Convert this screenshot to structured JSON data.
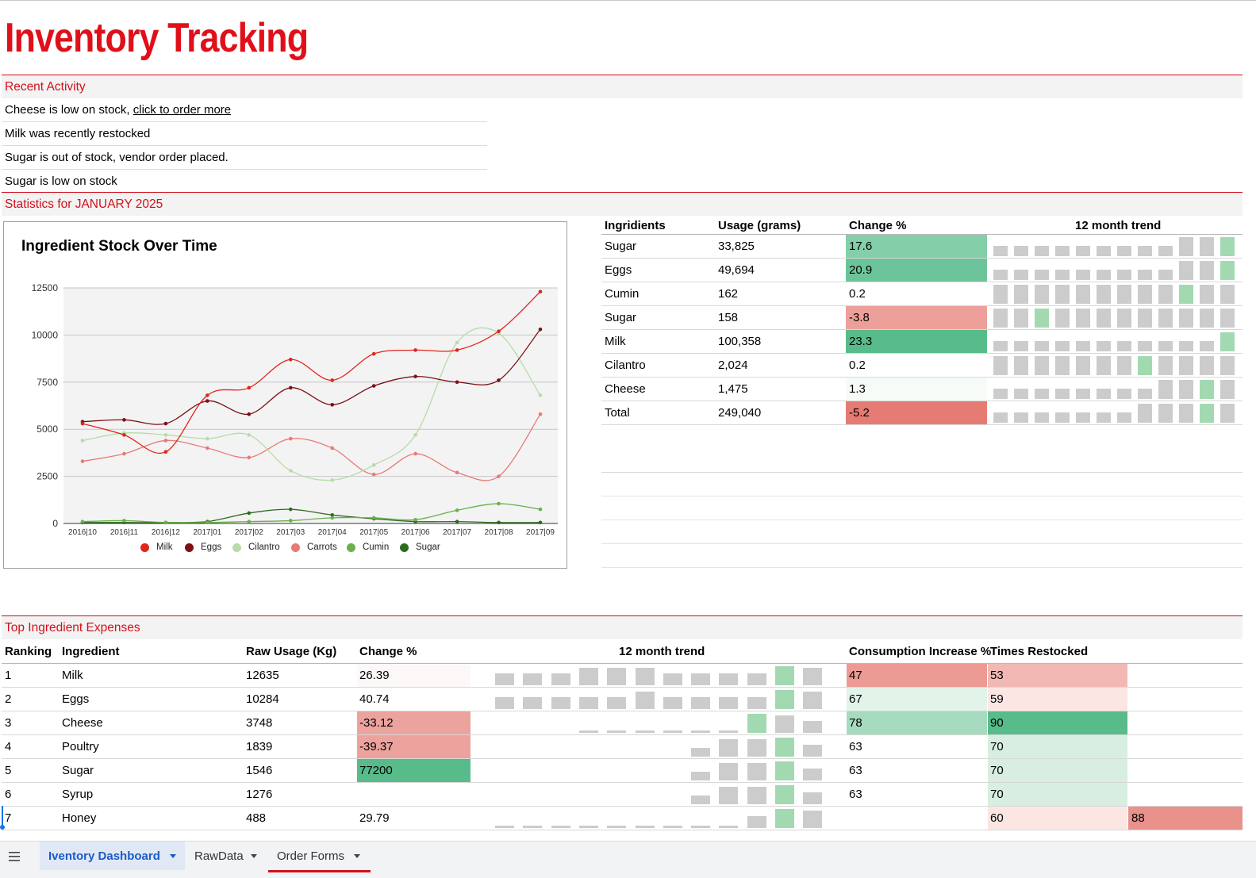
{
  "page_title": "Inventory Tracking",
  "recent_activity": {
    "heading": "Recent Activity",
    "items": [
      {
        "text": "Cheese is low on stock, ",
        "link": "click to order more"
      },
      {
        "text": "Milk was recently restocked"
      },
      {
        "text": "Sugar is out of stock, vendor order placed."
      },
      {
        "text": "Sugar is low on stock"
      }
    ]
  },
  "statistics": {
    "heading": "Statistics for JANUARY 2025",
    "table": {
      "headers": [
        "Ingridients",
        "Usage (grams)",
        "Change %",
        "12 month trend"
      ],
      "rows": [
        {
          "name": "Sugar",
          "usage": "33,825",
          "change": "17.6",
          "color": "#84ceaa",
          "trend": [
            1,
            1,
            1,
            1,
            1,
            1,
            1,
            1,
            1,
            2,
            2,
            2
          ],
          "hi": 11
        },
        {
          "name": "Eggs",
          "usage": "49,694",
          "change": "20.9",
          "color": "#6cc59a",
          "trend": [
            1,
            1,
            1,
            1,
            1,
            1,
            1,
            1,
            1,
            2,
            2,
            2
          ],
          "hi": 11
        },
        {
          "name": "Cumin",
          "usage": "162",
          "change": "0.2",
          "color": "",
          "trend": [
            2,
            2,
            2,
            2,
            2,
            2,
            2,
            2,
            2,
            2,
            2,
            2
          ],
          "hi": 9
        },
        {
          "name": "Sugar",
          "usage": "158",
          "change": "-3.8",
          "color": "#eda09a",
          "trend": [
            2,
            2,
            2,
            2,
            2,
            2,
            2,
            2,
            2,
            2,
            2,
            2
          ],
          "hi": 2
        },
        {
          "name": "Milk",
          "usage": "100,358",
          "change": "23.3",
          "color": "#58bb8a",
          "trend": [
            1,
            1,
            1,
            1,
            1,
            1,
            1,
            1,
            1,
            1,
            1,
            2
          ],
          "hi": 11
        },
        {
          "name": "Cilantro",
          "usage": "2,024",
          "change": "0.2",
          "color": "",
          "trend": [
            2,
            2,
            2,
            2,
            2,
            2,
            2,
            2,
            2,
            2,
            2,
            2
          ],
          "hi": 7
        },
        {
          "name": "Cheese",
          "usage": "1,475",
          "change": "1.3",
          "color": "#f6fbf8",
          "trend": [
            1,
            1,
            1,
            1,
            1,
            1,
            1,
            1,
            2,
            2,
            2,
            2
          ],
          "hi": 10
        },
        {
          "name": "Total",
          "usage": "249,040",
          "change": "-5.2",
          "color": "#e67b73",
          "trend": [
            1,
            1,
            1,
            1,
            1,
            1,
            1,
            2,
            2,
            2,
            2,
            2
          ],
          "hi": 10
        }
      ]
    }
  },
  "chart_data": {
    "type": "line",
    "title": "Ingredient Stock Over Time",
    "categories": [
      "2016|10",
      "2016|11",
      "2016|12",
      "2017|01",
      "2017|02",
      "2017|03",
      "2017|04",
      "2017|05",
      "2017|06",
      "2017|07",
      "2017|08",
      "2017|09"
    ],
    "ylim": [
      0,
      12500
    ],
    "yticks": [
      "12500",
      "10000",
      "7500",
      "5000",
      "2500",
      "0"
    ],
    "grid": true,
    "legend_position": "bottom",
    "series": [
      {
        "name": "Milk",
        "color": "#e1251b",
        "values": [
          5300,
          4700,
          3800,
          6800,
          7200,
          8700,
          7600,
          9000,
          9200,
          9200,
          10200,
          12300
        ]
      },
      {
        "name": "Eggs",
        "color": "#7b1116",
        "values": [
          5400,
          5500,
          5300,
          6500,
          5800,
          7200,
          6300,
          7300,
          7800,
          7500,
          7600,
          10300
        ]
      },
      {
        "name": "Cilantro",
        "color": "#b7dca9",
        "values": [
          4400,
          4800,
          4700,
          4500,
          4700,
          2800,
          2300,
          3100,
          4700,
          9600,
          10100,
          6800
        ]
      },
      {
        "name": "Carrots",
        "color": "#e87a76",
        "values": [
          3300,
          3700,
          4400,
          4000,
          3500,
          4500,
          4000,
          2600,
          3700,
          2700,
          2500,
          5800
        ]
      },
      {
        "name": "Cumin",
        "color": "#6ab04c",
        "values": [
          100,
          150,
          50,
          50,
          100,
          150,
          300,
          300,
          200,
          700,
          1050,
          750
        ]
      },
      {
        "name": "Sugar",
        "color": "#2e6b1f",
        "values": [
          50,
          50,
          50,
          100,
          550,
          750,
          450,
          250,
          100,
          100,
          50,
          50
        ]
      }
    ]
  },
  "expenses": {
    "heading": "Top Ingredient Expenses",
    "headers": [
      "Ranking",
      "Ingredient",
      "Raw Usage (Kg)",
      "Change %",
      "12 month trend",
      "Consumption Increase %",
      "Times Restocked"
    ],
    "rows": [
      {
        "rank": "1",
        "name": "Milk",
        "raw": "12635",
        "change": "26.39",
        "change_color": "#fdf8f8",
        "consumption": "47",
        "cons_color": "#ec9a93",
        "restocked": "53",
        "rest_color": "#f2b8b3",
        "trend": [
          3,
          3,
          3,
          4,
          4,
          4,
          3,
          3,
          3,
          3,
          4,
          4
        ],
        "extra": "",
        "extra_color": ""
      },
      {
        "rank": "2",
        "name": "Eggs",
        "raw": "10284",
        "change": "40.74",
        "change_color": "",
        "consumption": "67",
        "cons_color": "#e2f3ea",
        "restocked": "59",
        "rest_color": "#fbe6e4",
        "trend": [
          3,
          3,
          3,
          3,
          3,
          4,
          3,
          3,
          3,
          3,
          4,
          4
        ],
        "extra": "",
        "extra_color": ""
      },
      {
        "rank": "3",
        "name": "Cheese",
        "raw": "3748",
        "change": "-33.12",
        "change_color": "#eda39d",
        "consumption": "78",
        "cons_color": "#a6dbbf",
        "restocked": "90",
        "rest_color": "#57bb8a",
        "trend": [
          0,
          0,
          1,
          1,
          1,
          1,
          1,
          1,
          4,
          4,
          3
        ],
        "trend_offset": 1,
        "extra": "",
        "extra_color": ""
      },
      {
        "rank": "4",
        "name": "Poultry",
        "raw": "1839",
        "change": "-39.37",
        "change_color": "#eda39d",
        "consumption": "63",
        "cons_color": "",
        "restocked": "70",
        "rest_color": "#d7eee1",
        "trend": [
          2,
          4,
          4,
          4,
          3
        ],
        "trend_offset": 7,
        "extra": "",
        "extra_color": ""
      },
      {
        "rank": "5",
        "name": "Sugar",
        "raw": "1546",
        "change": "77200",
        "change_color": "#57bb8a",
        "consumption": "63",
        "cons_color": "",
        "restocked": "70",
        "rest_color": "#d7eee1",
        "trend": [
          2,
          4,
          4,
          4,
          3
        ],
        "trend_offset": 7,
        "extra": "",
        "extra_color": ""
      },
      {
        "rank": "6",
        "name": "Syrup",
        "raw": "1276",
        "change": "",
        "change_color": "",
        "consumption": "63",
        "cons_color": "",
        "restocked": "70",
        "rest_color": "#d7eee1",
        "trend": [
          2,
          4,
          4,
          4,
          3
        ],
        "trend_offset": 7,
        "extra": "",
        "extra_color": ""
      },
      {
        "rank": "7",
        "name": "Honey",
        "raw": "488",
        "change": "29.79",
        "change_color": "",
        "consumption": "",
        "cons_color": "",
        "restocked": "60",
        "rest_color": "#fbe6e4",
        "trend": [
          1,
          1,
          1,
          1,
          1,
          1,
          1,
          1,
          1,
          3,
          4,
          4
        ],
        "extra": "88",
        "extra_color": "#e8928b"
      }
    ]
  },
  "sheet_tabs": [
    {
      "label": "Iventory Dashboard",
      "active": true
    },
    {
      "label": "RawData",
      "active": false
    },
    {
      "label": "Order Forms",
      "active": false,
      "underline": "#d2101a"
    }
  ]
}
